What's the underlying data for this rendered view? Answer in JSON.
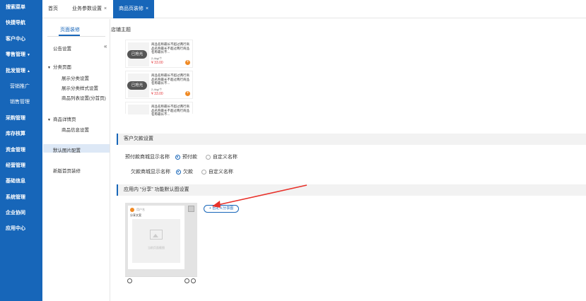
{
  "nav": {
    "items": [
      {
        "label": "搜索菜单"
      },
      {
        "label": "快捷导航"
      },
      {
        "label": "客户中心"
      },
      {
        "label": "零售管理",
        "arrow": "▼"
      },
      {
        "label": "批发管理",
        "arrow": "▲"
      },
      {
        "label": "营销推广"
      },
      {
        "label": "销售管理"
      },
      {
        "label": "采购管理"
      },
      {
        "label": "库存核算"
      },
      {
        "label": "资金管理"
      },
      {
        "label": "经营管理"
      },
      {
        "label": "基础信息"
      },
      {
        "label": "系统管理"
      },
      {
        "label": "企业协同"
      },
      {
        "label": "应用中心"
      }
    ]
  },
  "tabs": [
    {
      "label": "首页"
    },
    {
      "label": "业务参数设置",
      "close": "×"
    },
    {
      "label": "商品页装修",
      "close": "×"
    }
  ],
  "subpanel": {
    "tab_label": "页面装修",
    "collapse_icon": "«",
    "announcement": "公告设置",
    "category_page": {
      "title": "分类页面",
      "items": [
        "展示分类设置",
        "展示分类样式设置",
        "商品列表设置(分首页)"
      ]
    },
    "detail_page": {
      "title": "商品详情页",
      "items": [
        "商品信息设置"
      ]
    },
    "default_image": "默认图片配置",
    "new_home": "新版首页装修"
  },
  "main": {
    "shop_theme": "店铺主题",
    "product_cards": [
      {
        "sold_label": "已抢光",
        "title": "商品名称最长不超过两行商品名称最长不超过两行商品名称最长不...",
        "spec": "2-4kg/个",
        "price": "¥ 33.00"
      },
      {
        "sold_label": "已抢光",
        "title": "商品名称最长不超过两行商品名称最长不超过两行商品名称最长不...",
        "spec": "2-4kg/个",
        "price": "¥ 33.00"
      },
      {
        "title": "商品名称最长不超过两行商品名称最长不超过两行商品名称最长不..."
      }
    ],
    "debt_section": {
      "title": "客户欠款设置",
      "row1": {
        "label": "预付款商城显示名称",
        "opt1": "预付款",
        "opt2": "自定义名称"
      },
      "row2": {
        "label": "欠款商城显示名称",
        "opt1": "欠款",
        "opt2": "自定义名称"
      }
    },
    "share_section": {
      "title": "应用内 “分享” 功能默认图设置",
      "user_name": "用户名",
      "share_title": "分享文案",
      "image_caption": "当前页面截图",
      "custom_button": "+ 自定义分享图"
    }
  },
  "colors": {
    "primary": "#1766b9",
    "arrow": "#e8312a",
    "accent": "#f08a24"
  }
}
